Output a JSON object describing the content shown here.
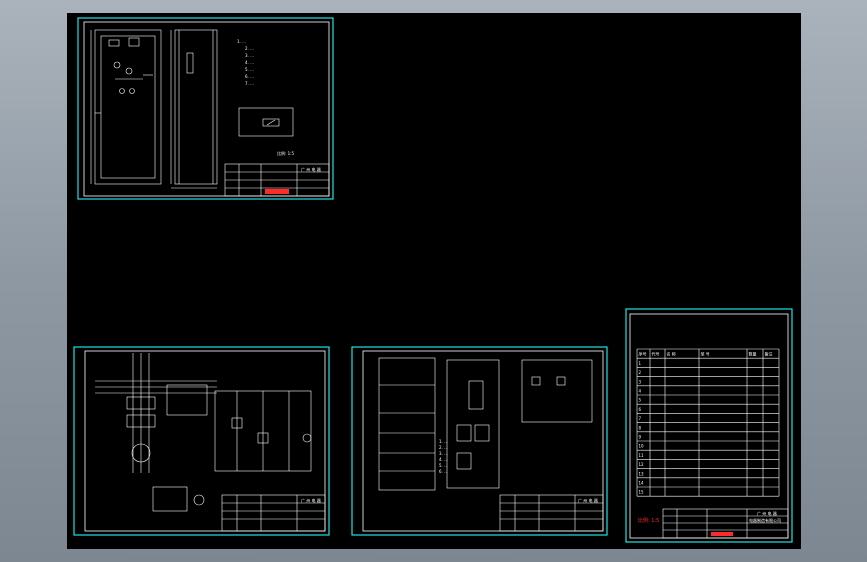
{
  "viewport": {
    "background_color": "#000000",
    "frame_color": "#1fe3e6",
    "line_color": "#ffffff",
    "highlight_color": "#ff2a2a"
  },
  "sheet1": {
    "notes": [
      "1. ...",
      "2. ...",
      "3. ...",
      "4. ...",
      "5. ...",
      "6. ...",
      "7. ..."
    ],
    "scale_label": "比例: 1:5",
    "title_block": {
      "company": "广 州 电 器",
      "red_text": ""
    }
  },
  "sheet2": {
    "title_block": {
      "company": "广 州 电 器"
    }
  },
  "sheet3": {
    "panel_title": "",
    "notes": [
      "1. ...",
      "2. ...",
      "3. ...",
      "4. ...",
      "5. ...",
      "6. ..."
    ],
    "title_block": {
      "company": "广 州 电 器"
    }
  },
  "sheet4": {
    "table_title": "",
    "headers": [
      "序号",
      "代号",
      "名 称",
      "型 号",
      "数量",
      "备注"
    ],
    "rows": [
      [
        "1",
        "",
        "",
        "",
        "",
        ""
      ],
      [
        "2",
        "",
        "",
        "",
        "",
        ""
      ],
      [
        "3",
        "",
        "",
        "",
        "",
        ""
      ],
      [
        "4",
        "",
        "",
        "",
        "",
        ""
      ],
      [
        "5",
        "",
        "",
        "",
        "",
        ""
      ],
      [
        "6",
        "",
        "",
        "",
        "",
        ""
      ],
      [
        "7",
        "",
        "",
        "",
        "",
        ""
      ],
      [
        "8",
        "",
        "",
        "",
        "",
        ""
      ],
      [
        "9",
        "",
        "",
        "",
        "",
        ""
      ],
      [
        "10",
        "",
        "",
        "",
        "",
        ""
      ],
      [
        "11",
        "",
        "",
        "",
        "",
        ""
      ],
      [
        "12",
        "",
        "",
        "",
        "",
        ""
      ],
      [
        "13",
        "",
        "",
        "",
        "",
        ""
      ],
      [
        "14",
        "",
        "",
        "",
        "",
        ""
      ],
      [
        "15",
        "",
        "",
        "",
        "",
        ""
      ]
    ],
    "scale_label": "比例: 1:5",
    "title_block": {
      "company": "广 州 电 器",
      "company_line2": "电器制造有限公司"
    }
  }
}
